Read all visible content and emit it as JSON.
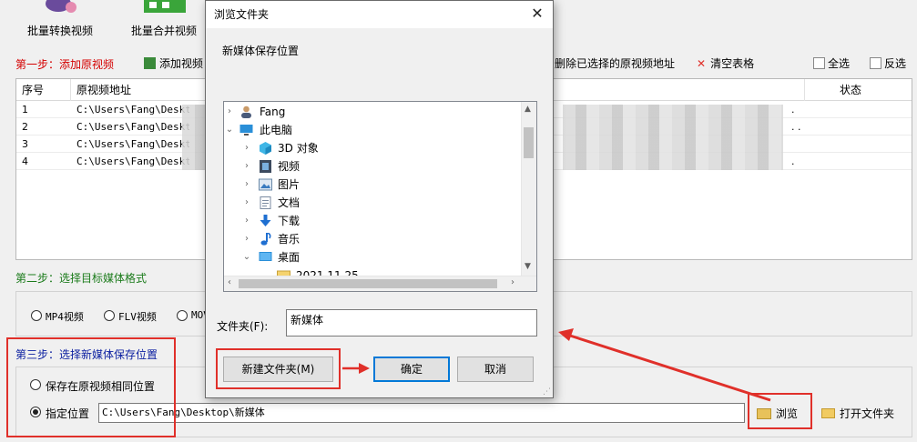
{
  "toolbar": {
    "batch_convert_label": "批量转换视频",
    "batch_merge_label": "批量合并视频"
  },
  "step1": {
    "label": "第一步：添加原视频",
    "add_video_label": "添加视频",
    "delete_selected_label": "删除已选择的原视频地址",
    "clear_table_label": "清空表格",
    "select_all_label": "全选",
    "invert_select_label": "反选"
  },
  "table": {
    "headers": {
      "index": "序号",
      "path": "原视频地址",
      "status": "状态"
    },
    "rows": [
      {
        "index": "1",
        "path": "C:\\Users\\Fang\\Deskt",
        "tail": "."
      },
      {
        "index": "2",
        "path": "C:\\Users\\Fang\\Deskt",
        "tail": ". ."
      },
      {
        "index": "3",
        "path": "C:\\Users\\Fang\\Deskt",
        "tail": ""
      },
      {
        "index": "4",
        "path": "C:\\Users\\Fang\\Deskt",
        "tail": "."
      }
    ]
  },
  "step2": {
    "label": "第二步：选择目标媒体格式",
    "formats": [
      "MP4视频",
      "FLV视频",
      "MOV"
    ]
  },
  "step3": {
    "label": "第三步：选择新媒体保存位置",
    "same_location_label": "保存在原视频相同位置",
    "specified_label": "指定位置",
    "path_value": "C:\\Users\\Fang\\Desktop\\新媒体",
    "browse_label": "浏览",
    "open_folder_label": "打开文件夹"
  },
  "dialog": {
    "title": "浏览文件夹",
    "close_glyph": "✕",
    "description": "新媒体保存位置",
    "tree": {
      "user": "Fang",
      "this_pc": "此电脑",
      "objects3d": "3D 对象",
      "videos": "视频",
      "pictures": "图片",
      "documents": "文档",
      "downloads": "下载",
      "music": "音乐",
      "desktop": "桌面",
      "folder_2021": "2021.11.25"
    },
    "folder_label": "文件夹(F):",
    "folder_value": "新媒体",
    "new_folder_label": "新建文件夹(M)",
    "ok_label": "确定",
    "cancel_label": "取消"
  },
  "colors": {
    "annotation_red": "#e0302a",
    "step1_red": "#d40000",
    "step2_green": "#1b7b1b",
    "step3_blue": "#0a1ea0",
    "default_button_blue": "#0078d7"
  }
}
